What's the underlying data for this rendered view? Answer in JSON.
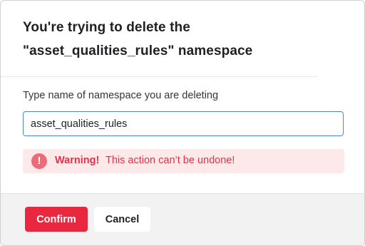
{
  "dialog": {
    "title_line1": "You're trying to delete the",
    "title_line2": "\"asset_qualities_rules\" namespace",
    "field_label": "Type name of namespace you are deleting",
    "input_value": "asset_qualities_rules",
    "warning": {
      "icon": "exclamation-icon",
      "title": "Warning!",
      "message": "This action can’t be undone!"
    },
    "buttons": {
      "confirm": "Confirm",
      "cancel": "Cancel"
    },
    "colors": {
      "danger": "#e8283f",
      "warning_bg": "#fde8ea",
      "focus_border": "#4a86d8",
      "footer_bg": "#f2f2f3"
    }
  }
}
